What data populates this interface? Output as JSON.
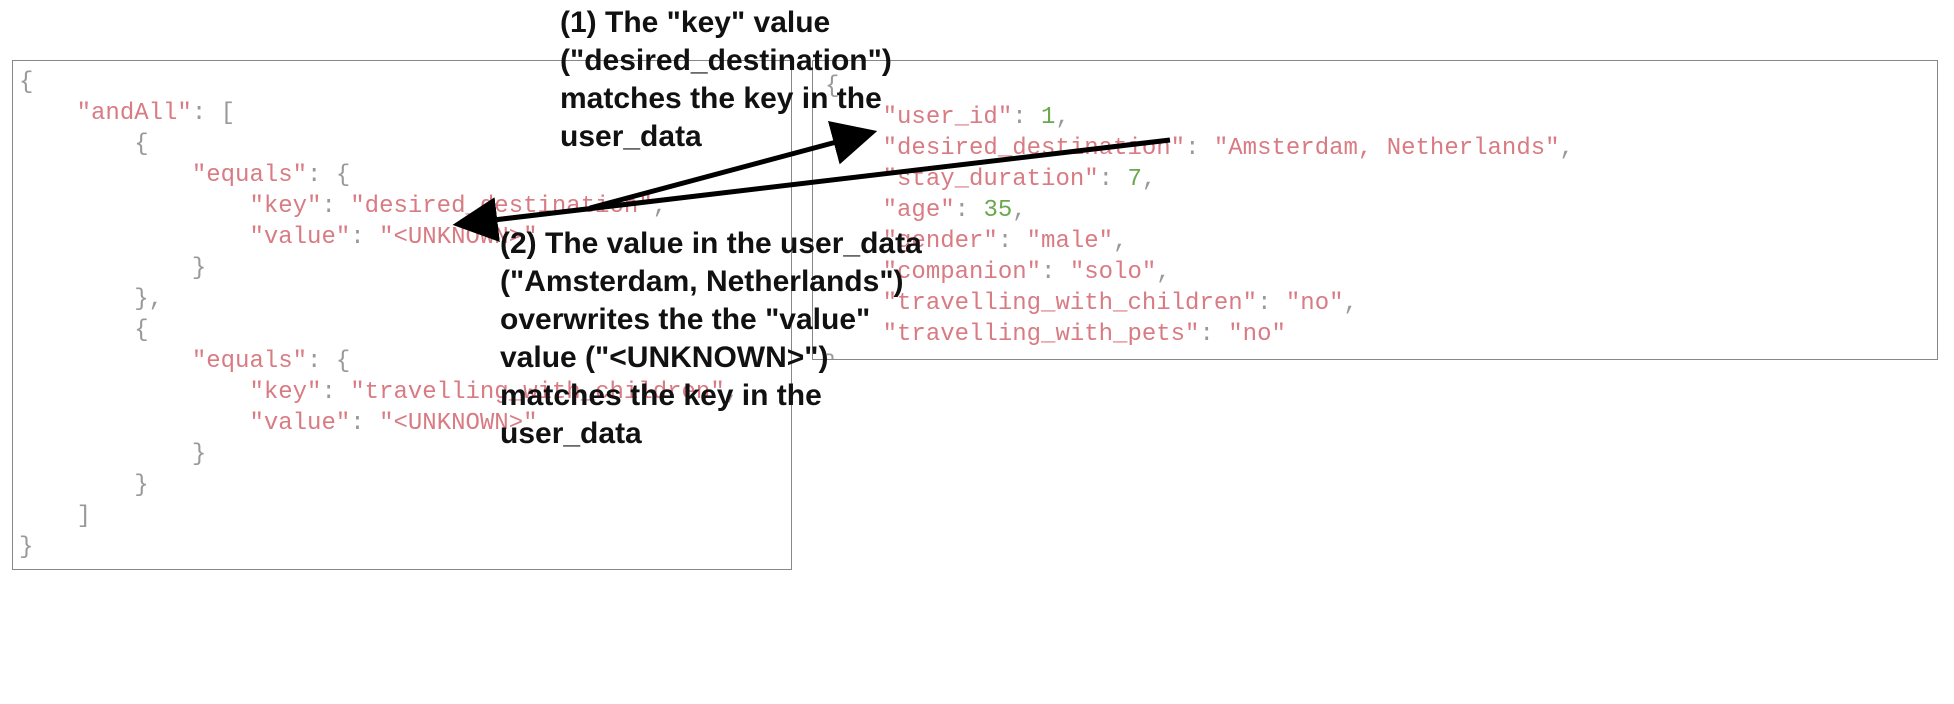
{
  "annotations": {
    "a1": "(1) The \"key\" value\n(\"desired_destination\")\nmatches the key in the\nuser_data",
    "a2": "(2) The value in the user_data\n(\"Amsterdam, Netherlands\")\noverwrites the the \"value\"\nvalue (\"<UNKNOWN>\")\nmatches the key in the\nuser_data"
  },
  "left_json": {
    "l0a": "{",
    "l1k": "\"andAll\"",
    "l1p": ": [",
    "l2a": "{",
    "l3k": "\"equals\"",
    "l3p": ": {",
    "l4k": "\"key\"",
    "l4p": ": ",
    "l4v": "\"desired_destination\"",
    "l4c": ",",
    "l5k": "\"value\"",
    "l5p": ": ",
    "l5v": "\"<UNKNOWN>\"",
    "l6a": "}",
    "l7a": "},",
    "l8a": "{",
    "l9k": "\"equals\"",
    "l9p": ": {",
    "l10k": "\"key\"",
    "l10p": ": ",
    "l10v": "\"travelling_with_children\"",
    "l10c": ",",
    "l11k": "\"value\"",
    "l11p": ": ",
    "l11v": "\"<UNKNOWN>\"",
    "l12a": "}",
    "l13a": "}",
    "l14a": "]",
    "l15a": "}"
  },
  "right_json": {
    "r0a": "{",
    "r1k": "\"user_id\"",
    "r1p": ": ",
    "r1v": "1",
    "r1c": ",",
    "r2k": "\"desired_destination\"",
    "r2p": ": ",
    "r2v": "\"Amsterdam, Netherlands\"",
    "r2c": ",",
    "r3k": "\"stay_duration\"",
    "r3p": ": ",
    "r3v": "7",
    "r3c": ",",
    "r4k": "\"age\"",
    "r4p": ": ",
    "r4v": "35",
    "r4c": ",",
    "r5k": "\"gender\"",
    "r5p": ": ",
    "r5v": "\"male\"",
    "r5c": ",",
    "r6k": "\"companion\"",
    "r6p": ": ",
    "r6v": "\"solo\"",
    "r6c": ",",
    "r7k": "\"travelling_with_children\"",
    "r7p": ": ",
    "r7v": "\"no\"",
    "r7c": ",",
    "r8k": "\"travelling_with_pets\"",
    "r8p": ": ",
    "r8v": "\"no\"",
    "r9a": "}"
  }
}
